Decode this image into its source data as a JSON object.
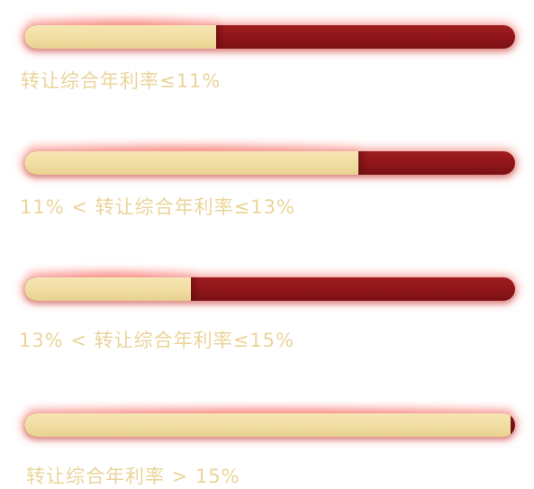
{
  "colors": {
    "track": "#8e1519",
    "fill": "#f0dca0",
    "label": "#ead49a",
    "glow": "#f05a50"
  },
  "bars": [
    {
      "label": "转让综合年利率≤11%",
      "fill_fraction": 0.39
    },
    {
      "label": "11% < 转让综合年利率≤13%",
      "fill_fraction": 0.68
    },
    {
      "label": "13% < 转让综合年利率≤15%",
      "fill_fraction": 0.34
    },
    {
      "label": "转让综合年利率 > 15%",
      "fill_fraction": 0.99
    }
  ]
}
